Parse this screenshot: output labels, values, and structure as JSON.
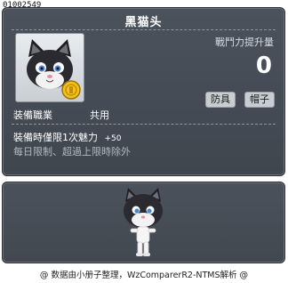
{
  "item_id": "01002549",
  "title": "黑猫头",
  "stat": {
    "label": "戰鬥力提升量",
    "value": "0"
  },
  "tags": [
    "防具",
    "帽子"
  ],
  "job": {
    "label": "装備職業",
    "value": "共用"
  },
  "description": {
    "line1": "裝備時僅限1次魅力",
    "line1_bonus": "+50",
    "line2": "每日限制、超過上限時除外"
  },
  "icons": {
    "item_icon": "black-cat-head-icon",
    "coin": "gold-coin-icon",
    "character": "cat-character-preview"
  },
  "colors": {
    "panel": "#454b54",
    "text": "#ffffff",
    "muted": "#b3b9c1"
  },
  "footer": "@ 数据由小册子整理，WzComparerR2-NTMS解析 @"
}
